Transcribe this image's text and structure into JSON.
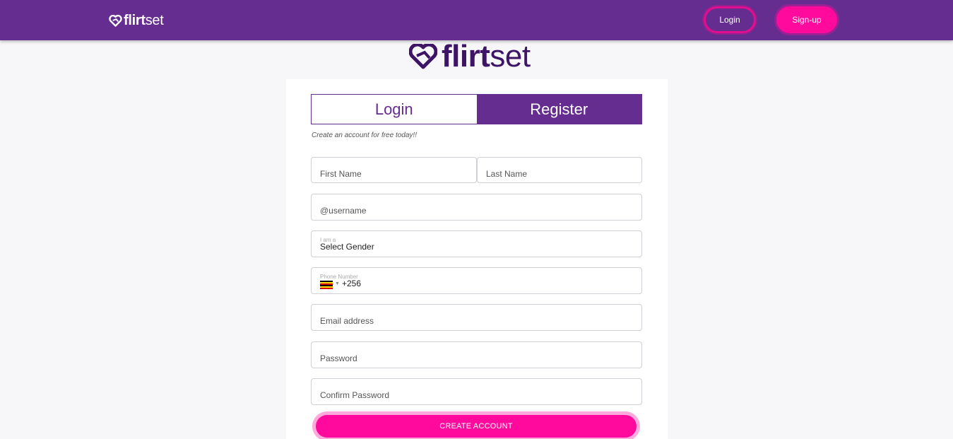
{
  "header": {
    "brand_bold": "flirt",
    "brand_light": "set",
    "login_label": "Login",
    "signup_label": "Sign-up"
  },
  "logo": {
    "bold": "flirt",
    "light": "set"
  },
  "tabs": [
    {
      "label": "Login",
      "active": false
    },
    {
      "label": "Register",
      "active": true
    }
  ],
  "form": {
    "tagline": "Create an account for free today!!",
    "first_name_placeholder": "First Name",
    "last_name_placeholder": "Last Name",
    "username_placeholder": "@username",
    "gender_label": "I am a",
    "gender_value": "Select Gender",
    "phone_label": "Phone Number",
    "phone_code": "+256",
    "email_placeholder": "Email address",
    "password_placeholder": "Password",
    "confirm_placeholder": "Confirm Password",
    "submit_label": "CREATE ACCOUNT"
  },
  "icons": {
    "brand_icon": "heart-logo-icon",
    "flag_icon": "uganda-flag-icon",
    "caret_icon": "chevron-down-icon"
  },
  "colors": {
    "primary_purple": "#662d91",
    "accent_pink": "#ff0a9c",
    "logo_dark": "#3d1466"
  }
}
